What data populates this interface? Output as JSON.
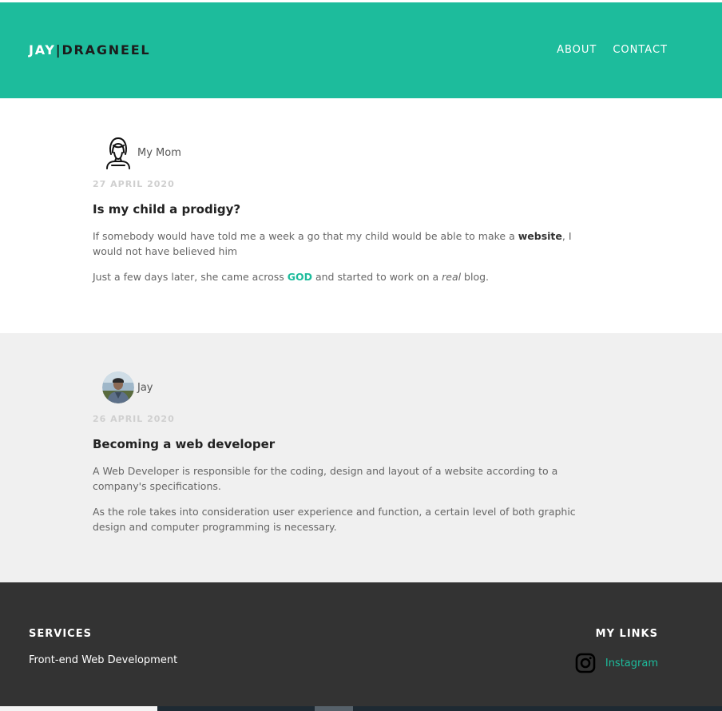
{
  "header": {
    "brand_first": "JAY",
    "brand_sep": "|",
    "brand_last": "DRAGNEEL",
    "nav": [
      "ABOUT",
      "CONTACT"
    ],
    "accent_color": "#1dbc9c"
  },
  "posts": [
    {
      "author": "My Mom",
      "avatar_icon": "woman-outline-icon",
      "date": "27 APRIL 2020",
      "title": "Is my child a prodigy?",
      "p1_a": "If somebody would have told me a week a go that my child would be able to make a ",
      "p1_bold": "website",
      "p1_b": ", I would not have believed him",
      "p2_a": "Just a few days later, she came across ",
      "p2_god": "GOD",
      "p2_b": " and started to work on a ",
      "p2_italic": "real",
      "p2_c": " blog."
    },
    {
      "author": "Jay",
      "avatar_icon": "user-photo-avatar",
      "date": "26 APRIL 2020",
      "title": "Becoming a web developer",
      "p1": "A Web Developer is responsible for the coding, design and layout of a website according to a company's specifications.",
      "p2": "As the role takes into consideration user experience and function, a certain level of both graphic design and computer programming is necessary."
    }
  ],
  "footer": {
    "services_heading": "SERVICES",
    "services_item": "Front-end Web Development",
    "links_heading": "MY LINKS",
    "instagram_label": "Instagram",
    "instagram_icon": "instagram-icon"
  }
}
